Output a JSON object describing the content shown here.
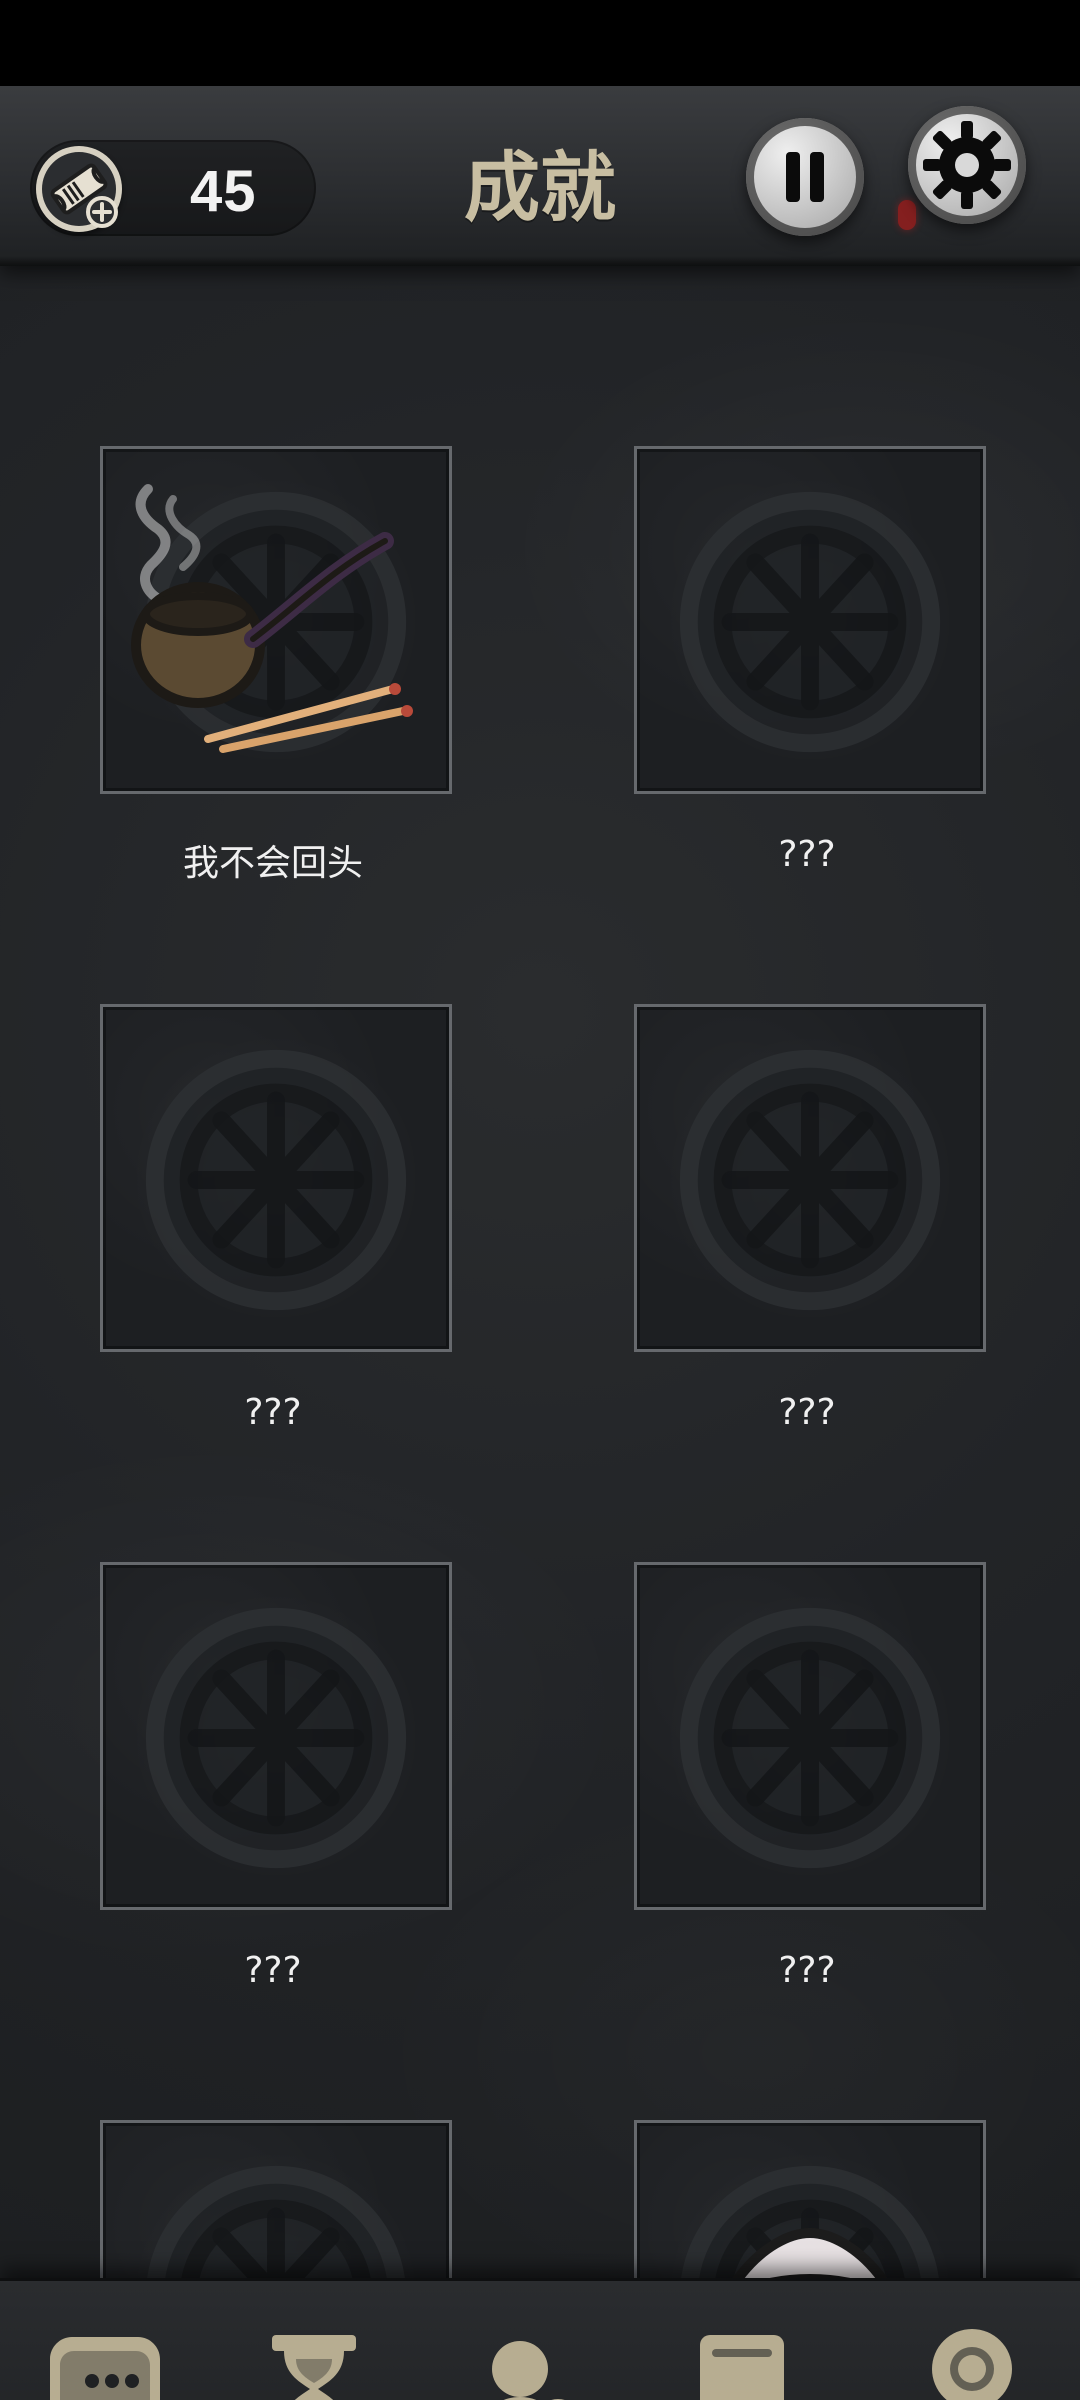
{
  "header": {
    "title": "成就",
    "ticket_count": "45"
  },
  "icons": {
    "ticket": "ticket-add-icon",
    "pause": "pause-icon",
    "settings": "gear-icon",
    "nav": [
      "chat-icon",
      "hourglass-icon",
      "add-user-icon",
      "book-icon",
      "award-ribbon-icon"
    ]
  },
  "achievements": {
    "items": [
      {
        "label": "我不会回头",
        "state": "unlocked"
      },
      {
        "label": "???",
        "state": "locked"
      },
      {
        "label": "???",
        "state": "locked"
      },
      {
        "label": "???",
        "state": "locked"
      },
      {
        "label": "???",
        "state": "locked"
      },
      {
        "label": "???",
        "state": "locked"
      },
      {
        "label": "",
        "state": "locked"
      },
      {
        "label": "",
        "state": "mask"
      }
    ]
  },
  "colors": {
    "accent": "#c8bea2"
  }
}
